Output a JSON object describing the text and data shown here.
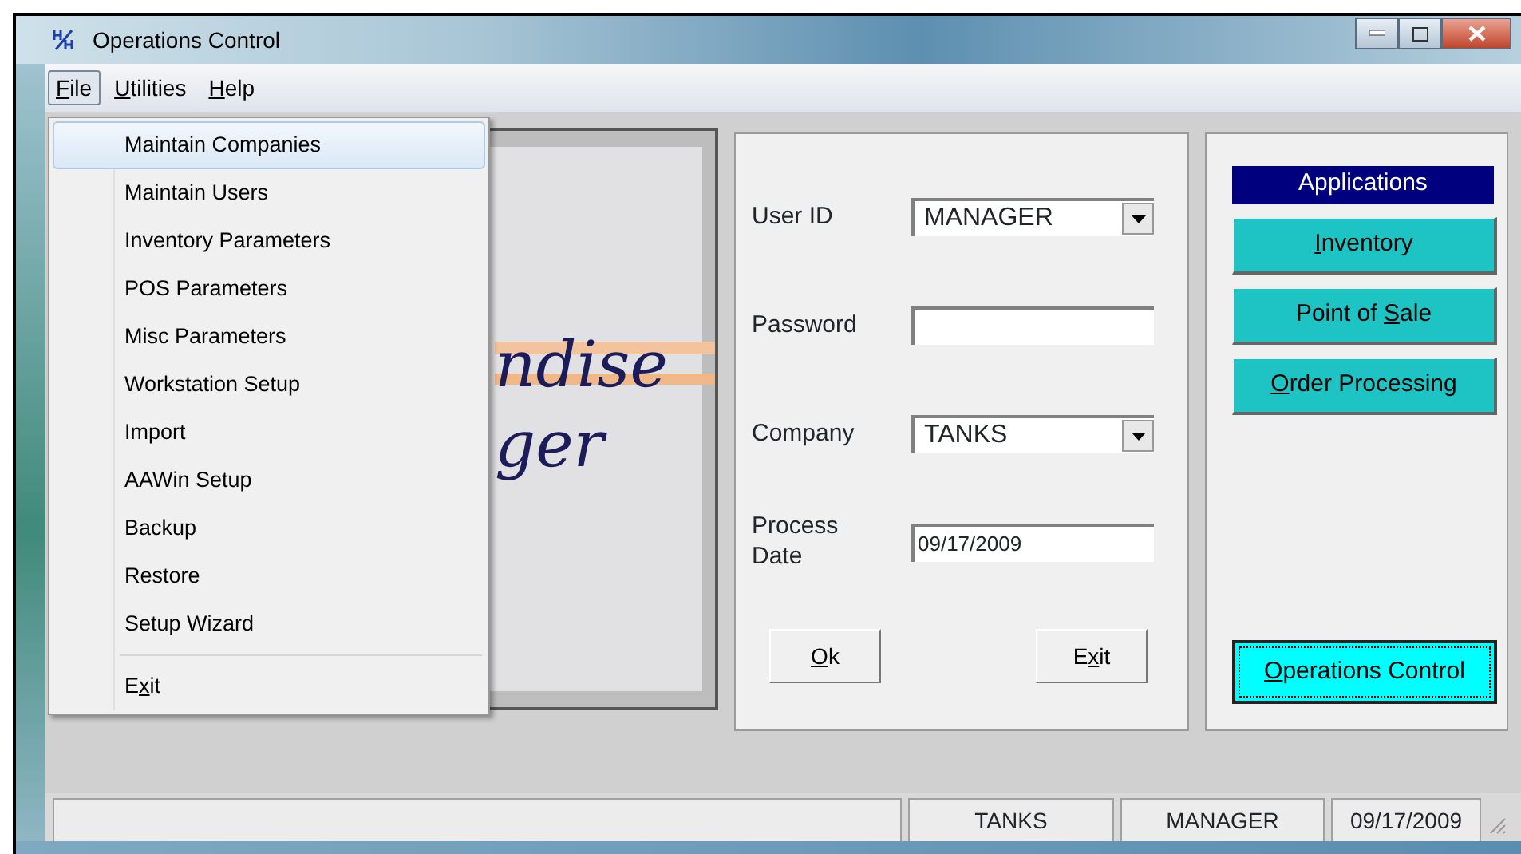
{
  "window": {
    "title": "Operations Control"
  },
  "menu_bar": [
    {
      "text": {
        "key": "F",
        "after": "ile"
      },
      "selected": true
    },
    {
      "text": {
        "key": "U",
        "after": "tilities"
      },
      "selected": false
    },
    {
      "text": {
        "key": "H",
        "after": "elp"
      },
      "selected": false
    }
  ],
  "file_menu": [
    {
      "kind": "item",
      "text": {
        "before": "Maintain Companies"
      },
      "selected": true
    },
    {
      "kind": "item",
      "text": {
        "before": "Maintain Users"
      },
      "selected": false
    },
    {
      "kind": "item",
      "text": {
        "before": "Inventory Parameters"
      },
      "selected": false
    },
    {
      "kind": "item",
      "text": {
        "before": "POS Parameters"
      },
      "selected": false
    },
    {
      "kind": "item",
      "text": {
        "before": "Misc Parameters"
      },
      "selected": false
    },
    {
      "kind": "item",
      "text": {
        "before": "Workstation Setup"
      },
      "selected": false
    },
    {
      "kind": "item",
      "text": {
        "before": "Import"
      },
      "selected": false
    },
    {
      "kind": "item",
      "text": {
        "before": "AAWin Setup"
      },
      "selected": false
    },
    {
      "kind": "item",
      "text": {
        "before": "Backup"
      },
      "selected": false
    },
    {
      "kind": "item",
      "text": {
        "before": "Restore"
      },
      "selected": false
    },
    {
      "kind": "item",
      "text": {
        "before": "Setup Wizard"
      },
      "selected": false
    },
    {
      "kind": "separator"
    },
    {
      "kind": "item",
      "text": {
        "before": "E",
        "key": "x",
        "after": "it"
      },
      "selected": false
    }
  ],
  "logo": {
    "lines": [
      "ndise",
      "ger"
    ]
  },
  "login": {
    "fields": [
      {
        "label": "User ID",
        "kind": "combo",
        "value": "MANAGER"
      },
      {
        "label": "Password",
        "kind": "text"
      },
      {
        "label": "Company",
        "kind": "combo",
        "value": "TANKS"
      },
      {
        "label": "Process Date",
        "kind": "text",
        "value": "09/17/2009"
      }
    ],
    "buttons": [
      {
        "text": {
          "key": "O",
          "after": "k"
        }
      },
      {
        "text": {
          "before": "E",
          "key": "x",
          "after": "it"
        }
      }
    ]
  },
  "applications": {
    "header": "Applications",
    "buttons": [
      {
        "text": {
          "key": "I",
          "after": "nventory"
        },
        "focused": false
      },
      {
        "text": {
          "before": "Point of ",
          "key": "S",
          "after": "ale"
        },
        "focused": false
      },
      {
        "text": {
          "key": "O",
          "after": "rder Processing"
        },
        "focused": false
      }
    ],
    "current": {
      "text": {
        "key": "O",
        "after": "perations Control"
      },
      "focused": true
    }
  },
  "status_bar": {
    "panels": [
      "TANKS",
      "MANAGER",
      "09/17/2009"
    ]
  }
}
